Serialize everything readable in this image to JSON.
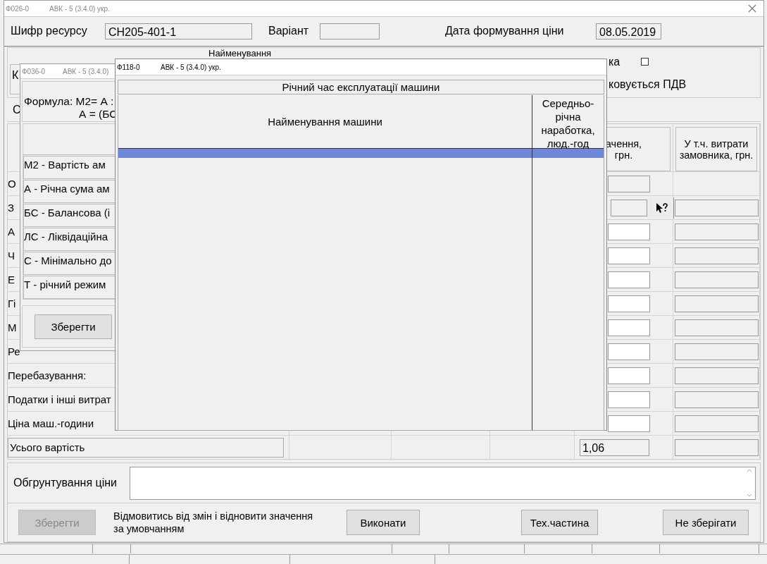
{
  "main_window": {
    "code": "Ф026-0",
    "title": "АВК - 5 (3.4.0) укр."
  },
  "header": {
    "resource_code_label": "Шифр ресурсу",
    "resource_code": "СН205-401-1",
    "variant_label": "Варіант",
    "date_label": "Дата формування ціни",
    "date": "08.05.2019"
  },
  "details": {
    "name_label": "Найменування",
    "left_label": "К",
    "checkbox_label": "ка",
    "checkbox_checked": false,
    "vat_label": "ковується ПДВ",
    "row3_label": "С"
  },
  "cost_table": {
    "columns": [
      "ачення, грн.",
      "У т.ч. витрати замовника, грн."
    ],
    "rows": [
      {
        "label": "О",
        "kind": "readonly"
      },
      {
        "label": "З",
        "kind": "lookup"
      },
      {
        "label": "А",
        "kind": "input"
      },
      {
        "label": "Ч",
        "kind": "input"
      },
      {
        "label": "Е",
        "kind": "input"
      },
      {
        "label": "Гі",
        "kind": "input"
      },
      {
        "label": "М",
        "kind": "input"
      },
      {
        "label": "Ре",
        "kind": "input"
      },
      {
        "label": "Перебазування:",
        "kind": "input"
      },
      {
        "label": "Податки  і інші витрат",
        "kind": "input"
      },
      {
        "label": "Ціна маш.-години",
        "kind": "input"
      }
    ],
    "total": {
      "label": "Усього вартість",
      "value": "1,06"
    }
  },
  "justification": {
    "label": "Обгрунтування ціни"
  },
  "footer": {
    "save_button": {
      "label": "Зберегти",
      "disabled": true
    },
    "reset_text": "Відмовитись від змін і відновити значення за умовчанням",
    "buttons": [
      "Виконати",
      "Тех.частина",
      "Не зберігати"
    ]
  },
  "formula_window": {
    "code": "Ф036-0",
    "title": "АВК - 5 (3.4.0)",
    "formula_lines": [
      "Формула: М2= А :",
      "А = (БС"
    ],
    "rows": [
      "М2 - Вартість ам",
      "А - Річна сума ам",
      "БС - Балансова (і",
      "ЛС - Ліквідаційна",
      "С - Мінімально до",
      "Т - річний режим"
    ],
    "save_button": "Зберегти"
  },
  "machine_window": {
    "code": "Ф118-0",
    "title": "АВК - 5 (3.4.0) укр.",
    "heading": "Річний час експлуатації машини",
    "columns": [
      "Найменування машини",
      "Середньо-річна наработка, люд.-год"
    ],
    "rows": [
      {
        "selected": true
      }
    ]
  }
}
